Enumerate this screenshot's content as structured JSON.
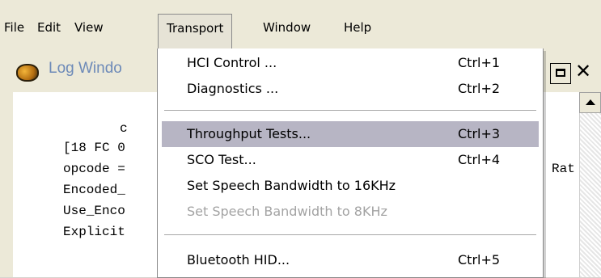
{
  "menubar": {
    "items": [
      "File",
      "Edit",
      "View",
      "Transport",
      "Window",
      "Help"
    ],
    "open_menu": "Transport"
  },
  "log_window": {
    "title": "Log Windo",
    "lines": [
      "c",
      "[18 FC 0",
      "opcode =",
      "Encoded_",
      "Use_Enco",
      "Explicit"
    ],
    "right_fragment": "Rat"
  },
  "transport_menu": {
    "items": [
      {
        "label": "HCI Control ...",
        "accel": "Ctrl+1",
        "state": "normal"
      },
      {
        "label": "Diagnostics ...",
        "accel": "Ctrl+2",
        "state": "normal"
      },
      {
        "label": "Throughput Tests...",
        "accel": "Ctrl+3",
        "state": "highlighted"
      },
      {
        "label": "SCO Test...",
        "accel": "Ctrl+4",
        "state": "normal"
      },
      {
        "label": "Set Speech Bandwidth to 16KHz",
        "accel": "",
        "state": "normal"
      },
      {
        "label": "Set Speech Bandwidth to 8KHz",
        "accel": "",
        "state": "disabled"
      },
      {
        "label": "Bluetooth HID...",
        "accel": "Ctrl+5",
        "state": "normal"
      }
    ],
    "highlight_color": "#b7b5c4",
    "disabled_color": "#a3a3a3"
  }
}
